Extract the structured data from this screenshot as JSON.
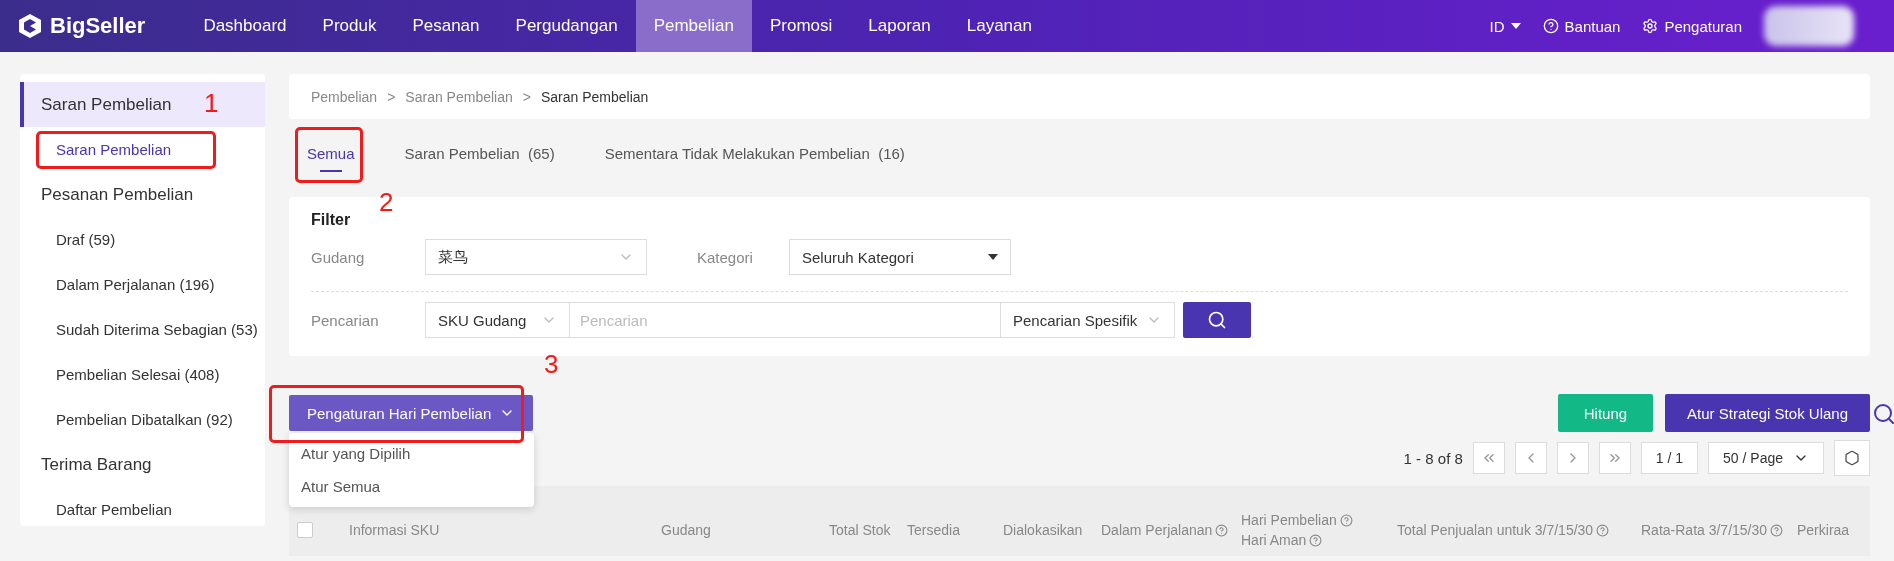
{
  "brand": "BigSeller",
  "nav": [
    {
      "label": "Dashboard",
      "selected": false
    },
    {
      "label": "Produk",
      "selected": false
    },
    {
      "label": "Pesanan",
      "selected": false
    },
    {
      "label": "Pergudangan",
      "selected": false
    },
    {
      "label": "Pembelian",
      "selected": true
    },
    {
      "label": "Promosi",
      "selected": false
    },
    {
      "label": "Laporan",
      "selected": false
    },
    {
      "label": "Layanan",
      "selected": false
    }
  ],
  "top_right": {
    "language": "ID",
    "help": "Bantuan",
    "settings": "Pengaturan"
  },
  "sidebar": [
    {
      "label": "Saran Pembelian",
      "selected": true,
      "annotation": "1",
      "children": [
        {
          "label": "Saran Pembelian",
          "selected": true
        }
      ]
    },
    {
      "label": "Pesanan Pembelian",
      "selected": false,
      "children": [
        {
          "label": "Draf (59)",
          "selected": false
        },
        {
          "label": "Dalam Perjalanan (196)",
          "selected": false
        },
        {
          "label": "Sudah Diterima Sebagian (53)",
          "selected": false
        },
        {
          "label": "Pembelian Selesai (408)",
          "selected": false
        },
        {
          "label": "Pembelian Dibatalkan (92)",
          "selected": false
        }
      ]
    },
    {
      "label": "Terima Barang",
      "selected": false,
      "children": [
        {
          "label": "Daftar Pembelian",
          "selected": false
        }
      ]
    }
  ],
  "breadcrumb": {
    "separator": ">",
    "items": [
      "Pembelian",
      "Saran Pembelian",
      "Saran Pembelian"
    ]
  },
  "tabs": [
    {
      "label": "Semua",
      "selected": true,
      "annotation": "2"
    },
    {
      "label": "Saran Pembelian",
      "count": "(65)",
      "selected": false
    },
    {
      "label": "Sementara Tidak Melakukan Pembelian",
      "count": "(16)",
      "selected": false
    }
  ],
  "filter": {
    "title": "Filter",
    "warehouse": {
      "label": "Gudang",
      "value": "菜鸟"
    },
    "category": {
      "label": "Kategori",
      "value": "Seluruh Kategori"
    },
    "search": {
      "label": "Pencarian",
      "type": "SKU Gudang",
      "placeholder": "Pencarian",
      "mode": "Pencarian Spesifik"
    }
  },
  "actions": {
    "dropdown": {
      "label": "Pengaturan Hari Pembelian",
      "annotation": "3",
      "menu": [
        "Atur yang Dipilih",
        "Atur Semua"
      ]
    },
    "buttons": [
      {
        "label": "Hitung",
        "kind": "green"
      },
      {
        "label": "Atur Strategi Stok Ulang",
        "kind": "primary"
      }
    ]
  },
  "pagination": {
    "summary": "1 - 8 of 8",
    "page": "1 / 1",
    "page_size": "50 / Page"
  },
  "table": {
    "select_all_checked": false,
    "columns": [
      {
        "lines": [
          "Informasi SKU"
        ],
        "help": false
      },
      {
        "lines": [
          "Gudang"
        ],
        "help": false
      },
      {
        "lines": [
          "Total Stok"
        ],
        "help": false
      },
      {
        "lines": [
          "Tersedia"
        ],
        "help": false
      },
      {
        "lines": [
          "Dialokasikan"
        ],
        "help": false
      },
      {
        "lines": [
          "Dalam Perjalanan"
        ],
        "help": true
      },
      {
        "lines": [
          "Hari Pembelian",
          "Hari Aman"
        ],
        "help": true
      },
      {
        "lines": [
          "Total Penjualan untuk 3/7/15/30"
        ],
        "help": true
      },
      {
        "lines": [
          "Rata-Rata 3/7/15/30"
        ],
        "help": true
      },
      {
        "lines": [
          "Perkiraa"
        ],
        "help": false
      }
    ]
  }
}
